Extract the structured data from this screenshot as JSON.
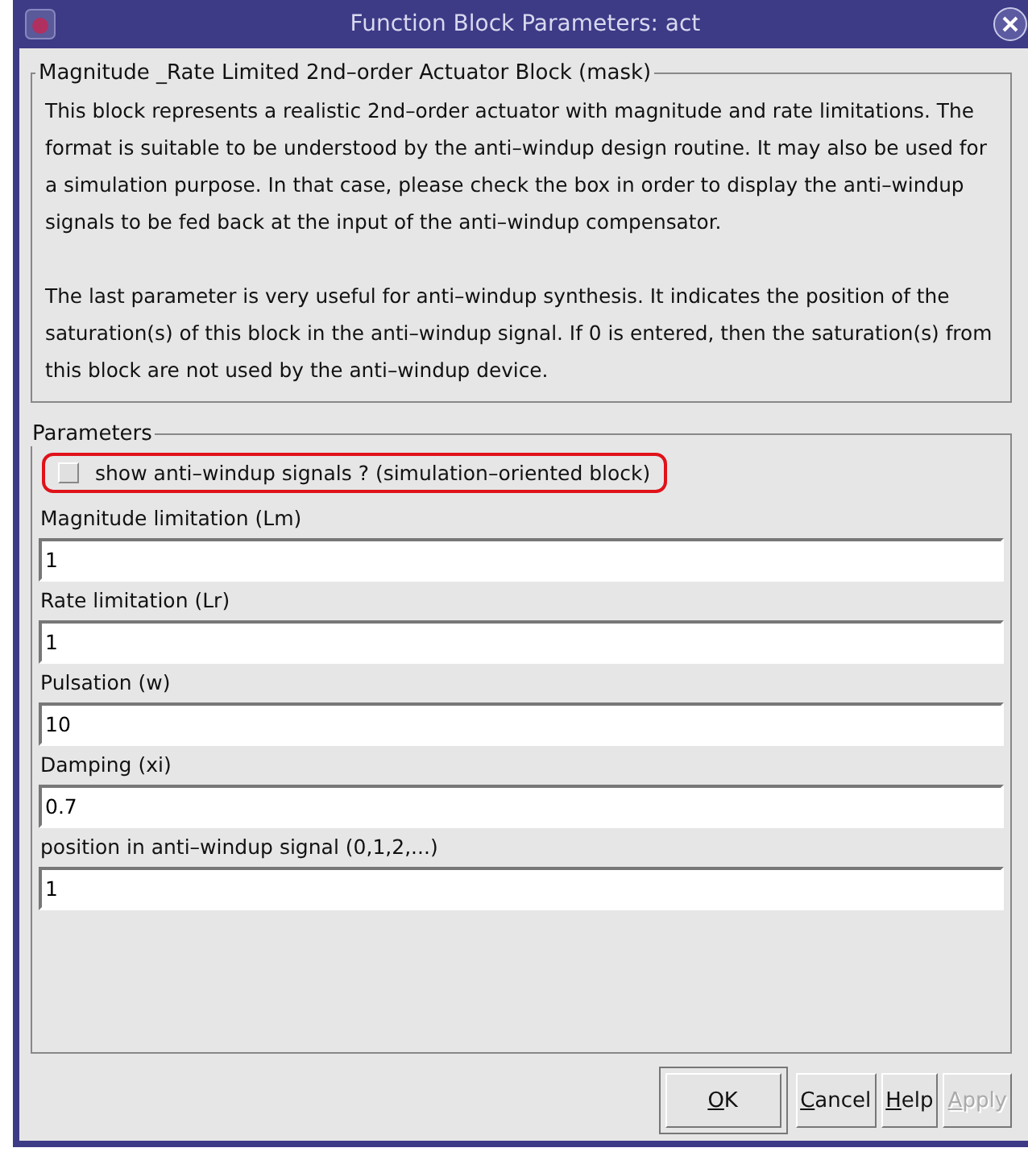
{
  "window": {
    "title": "Function Block Parameters: act"
  },
  "description": {
    "title": "Magnitude _Rate Limited 2nd–order Actuator Block  (mask)",
    "paragraphs": [
      "This block represents a realistic 2nd–order actuator with magnitude and rate limitations.  The format is suitable to be understood by the anti–windup design routine. It may also be used for a simulation purpose. In that case, please check the box in order to display the anti–windup signals to be fed back at the input of the anti–windup compensator.",
      "The last parameter is very useful for anti–windup synthesis. It indicates the position of the saturation(s) of this block  in the anti–windup signal. If 0 is entered, then the saturation(s) from this block are not used by the anti–windup device."
    ]
  },
  "parameters": {
    "title": "Parameters",
    "checkbox": {
      "label": "show anti–windup signals ? (simulation–oriented block)",
      "checked": false,
      "highlighted": true
    },
    "fields": [
      {
        "label": "Magnitude limitation (Lm)",
        "value": "1"
      },
      {
        "label": "Rate limitation (Lr)",
        "value": "1"
      },
      {
        "label": "Pulsation (w)",
        "value": "10"
      },
      {
        "label": "Damping (xi)",
        "value": "0.7"
      },
      {
        "label": "position in anti–windup signal (0,1,2,...)",
        "value": "1"
      }
    ]
  },
  "buttons": [
    {
      "mnemonic": "O",
      "rest": "K",
      "disabled": false,
      "default": true
    },
    {
      "mnemonic": "C",
      "rest": "ancel",
      "disabled": false,
      "default": false
    },
    {
      "mnemonic": "H",
      "rest": "elp",
      "disabled": false,
      "default": false
    },
    {
      "mnemonic": "A",
      "rest": "pply",
      "disabled": true,
      "default": false
    }
  ]
}
